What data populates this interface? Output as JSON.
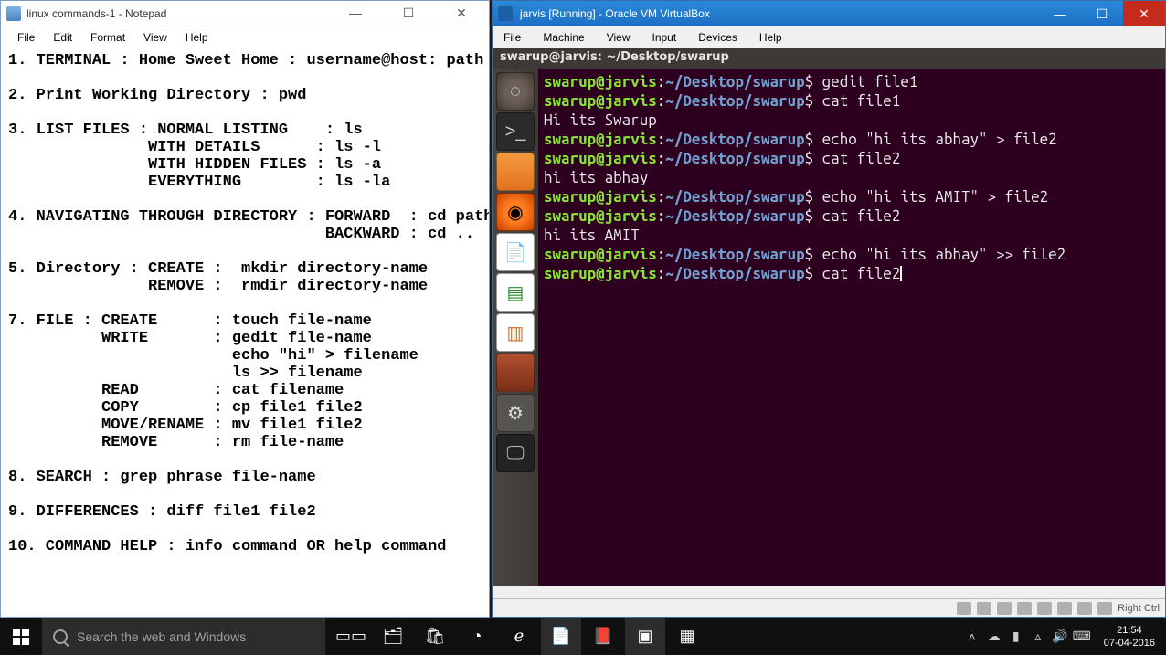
{
  "notepad": {
    "title": "linux commands-1 - Notepad",
    "menus": [
      "File",
      "Edit",
      "Format",
      "View",
      "Help"
    ],
    "content": "1. TERMINAL : Home Sweet Home : username@host: path\n\n2. Print Working Directory : pwd\n\n3. LIST FILES : NORMAL LISTING    : ls\n               WITH DETAILS      : ls -l\n               WITH HIDDEN FILES : ls -a\n               EVERYTHING        : ls -la\n\n4. NAVIGATING THROUGH DIRECTORY : FORWARD  : cd path\n                                  BACKWARD : cd ..\n\n5. Directory : CREATE :  mkdir directory-name\n               REMOVE :  rmdir directory-name\n\n7. FILE : CREATE      : touch file-name\n          WRITE       : gedit file-name\n                        echo \"hi\" > filename\n                        ls >> filename\n          READ        : cat filename\n          COPY        : cp file1 file2\n          MOVE/RENAME : mv file1 file2\n          REMOVE      : rm file-name\n\n8. SEARCH : grep phrase file-name\n\n9. DIFFERENCES : diff file1 file2\n\n10. COMMAND HELP : info command OR help command"
  },
  "vm": {
    "title": "jarvis [Running] - Oracle VM VirtualBox",
    "menus": [
      "File",
      "Machine",
      "View",
      "Input",
      "Devices",
      "Help"
    ],
    "gnomeTitle": "swarup@jarvis: ~/Desktop/swarup",
    "prompt_user": "swarup@jarvis",
    "prompt_path": "~/Desktop/swarup",
    "lines": [
      {
        "type": "cmd",
        "text": "gedit file1"
      },
      {
        "type": "cmd",
        "text": "cat file1"
      },
      {
        "type": "out",
        "text": "Hi its Swarup"
      },
      {
        "type": "cmd",
        "text": "echo \"hi its abhay\" > file2"
      },
      {
        "type": "cmd",
        "text": "cat file2"
      },
      {
        "type": "out",
        "text": "hi its abhay"
      },
      {
        "type": "cmd",
        "text": "echo \"hi its AMIT\" > file2"
      },
      {
        "type": "cmd",
        "text": "cat file2"
      },
      {
        "type": "out",
        "text": "hi its AMIT"
      },
      {
        "type": "cmd",
        "text": "echo \"hi its abhay\" >> file2"
      },
      {
        "type": "cmd",
        "text": "cat file2",
        "cursor": true
      }
    ],
    "status_hostkey": "Right Ctrl"
  },
  "taskbar": {
    "search_placeholder": "Search the web and Windows",
    "clock_time": "21:54",
    "clock_date": "07-04-2016"
  }
}
